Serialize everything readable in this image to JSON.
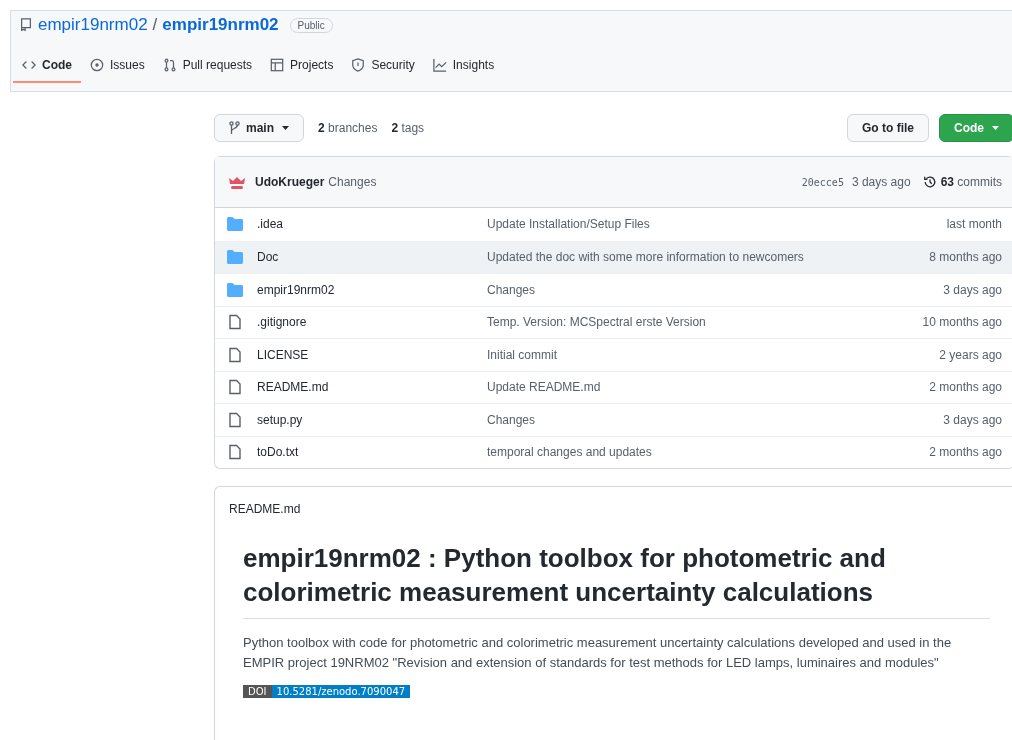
{
  "repo": {
    "owner": "empir19nrm02",
    "separator": "/",
    "name": "empir19nrm02",
    "visibility": "Public"
  },
  "tabs": [
    {
      "label": "Code",
      "selected": true
    },
    {
      "label": "Issues",
      "selected": false
    },
    {
      "label": "Pull requests",
      "selected": false
    },
    {
      "label": "Projects",
      "selected": false
    },
    {
      "label": "Security",
      "selected": false
    },
    {
      "label": "Insights",
      "selected": false
    }
  ],
  "toolbar": {
    "branch": "main",
    "branches_count": "2",
    "branches_label": "branches",
    "tags_count": "2",
    "tags_label": "tags",
    "go_to_file": "Go to file",
    "code_button": "Code"
  },
  "commit": {
    "author": "UdoKrueger",
    "message": "Changes",
    "sha": "20ecce5",
    "time": "3 days ago",
    "commits_count": "63",
    "commits_label": "commits"
  },
  "files": [
    {
      "kind": "folder",
      "name": ".idea",
      "message": "Update Installation/Setup Files",
      "time": "last month",
      "hovered": false
    },
    {
      "kind": "folder",
      "name": "Doc",
      "message": "Updated the doc with some more information to newcomers",
      "time": "8 months ago",
      "hovered": true
    },
    {
      "kind": "folder",
      "name": "empir19nrm02",
      "message": "Changes",
      "time": "3 days ago",
      "hovered": false
    },
    {
      "kind": "file",
      "name": ".gitignore",
      "message": "Temp. Version: MCSpectral erste Version",
      "time": "10 months ago",
      "hovered": false
    },
    {
      "kind": "file",
      "name": "LICENSE",
      "message": "Initial commit",
      "time": "2 years ago",
      "hovered": false
    },
    {
      "kind": "file",
      "name": "README.md",
      "message": "Update README.md",
      "time": "2 months ago",
      "hovered": false
    },
    {
      "kind": "file",
      "name": "setup.py",
      "message": "Changes",
      "time": "3 days ago",
      "hovered": false
    },
    {
      "kind": "file",
      "name": "toDo.txt",
      "message": "temporal changes and updates",
      "time": "2 months ago",
      "hovered": false
    }
  ],
  "readme": {
    "filename": "README.md",
    "heading": "empir19nrm02 : Python toolbox for photometric and colorimetric measurement uncertainty calculations",
    "paragraph": "Python toolbox with code for photometric and colorimetric measurement uncertainty calculations developed and used in the EMPIR project 19NRM02 \"Revision and extension of standards for test methods for LED lamps, luminaires and modules\"",
    "badge_label": "DOI",
    "badge_value": "10.5281/zenodo.7090047"
  }
}
